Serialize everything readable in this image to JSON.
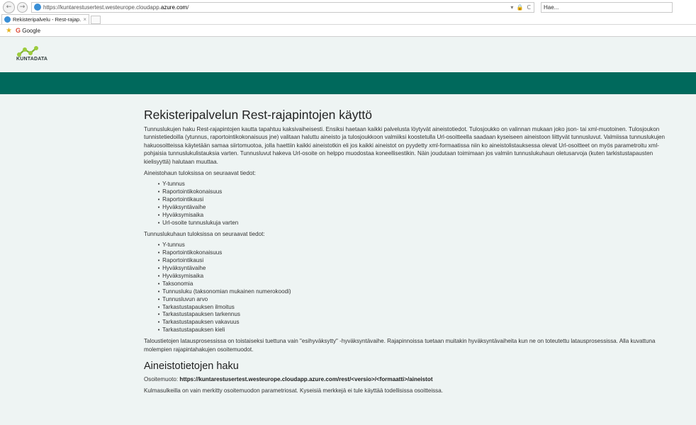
{
  "browser": {
    "url_prefix": "https://kuntarestusertest.westeurope.cloudapp.",
    "url_host": "azure.com",
    "url_suffix": "/",
    "addr_tools": "▾ 🔒 C",
    "search_placeholder": "Hae...",
    "tab_title": "Rekisteripalvelu - Rest-rajap...",
    "tab_close": "×",
    "favorite_label": "Google",
    "favorite_g": "G"
  },
  "site": {
    "logo_text": "KUNTADATA",
    "brand_color": "#00695c"
  },
  "main": {
    "title": "Rekisteripalvelun Rest-rajapintojen käyttö",
    "intro": "Tunnuslukujen haku Rest-rajapintojen kautta tapahtuu kaksivaiheisesti. Ensiksi haetaan kaikki palvelusta löytyvät aineistotiedot. Tulosjoukko on valinnan mukaan joko json- tai xml-muotoinen. Tulosjoukon tunnistetiedoilla (ytunnus, raportointikokonaisuus jne) valitaan haluttu aineisto ja tulosjoukkoon valmiiksi koostetulla Url-osoitteella saadaan kyseiseen aineistoon liittyvät tunnusluvut. Valmiissa tunnuslukujen hakuosoitteissa käytetään samaa siirtomuotoa, jolla haettiin kaikki aineistotkin eli jos kaikki aineistot on pyydetty xml-formaatissa niin ko aineistolistauksessa olevat Url-osoitteet on myös parametroitu xml-pohjaisia tunnuslukulistauksia varten. Tunnusluvut hakeva Url-osoite on helppo muodostaa koneellisestikin. Näin joudutaan toimimaan jos valmiin tunnuslukuhaun oletusarvoja (kuten tarkistustapausten kielisyyttä) halutaan muuttaa.",
    "aineisto_heading": "Aineistohaun tuloksissa on seuraavat tiedot:",
    "aineisto_items": [
      "Y-tunnus",
      "Raportointikokonaisuus",
      "Raportointikausi",
      "Hyväksyntävaihe",
      "Hyväksymisaika",
      "Url-osoite tunnuslukuja varten"
    ],
    "tunnusluku_heading": "Tunnuslukuhaun tuloksissa on seuraavat tiedot:",
    "tunnusluku_items": [
      "Y-tunnus",
      "Raportointikokonaisuus",
      "Raportointikausi",
      "Hyväksyntävaihe",
      "Hyväksymisaika",
      "Taksonomia",
      "Tunnusluku (taksonomian mukainen numerokoodi)",
      "Tunnusluvun arvo",
      "Tarkastustapauksen ilmoitus",
      "Tarkastustapauksen tarkennus",
      "Tarkastustapauksen vakavuus",
      "Tarkastustapauksen kieli"
    ],
    "closing": "Taloustietojen latausprosessissa on toistaiseksi tuettuna vain \"esihyväksytty\" -hyväksyntävaihe. Rajapinnoissa tuetaan muitakin hyväksyntävaiheita kun ne on toteutettu latausprosessissa. Alla kuvattuna molempien rajapintahakujen osoitemuodot.",
    "section2_title": "Aineistotietojen haku",
    "address_label": "Osoitemuoto: ",
    "address_format": "https://kuntarestusertest.westeurope.cloudapp.azure.com/rest/<versio>/<formaatti>/aineistot",
    "cut_line": "Kulmasulkeilla on vain merkitty osoitemuodon parametriosat. Kyseisiä merkkejä ei tule käyttää todellisissa osoitteissa."
  }
}
